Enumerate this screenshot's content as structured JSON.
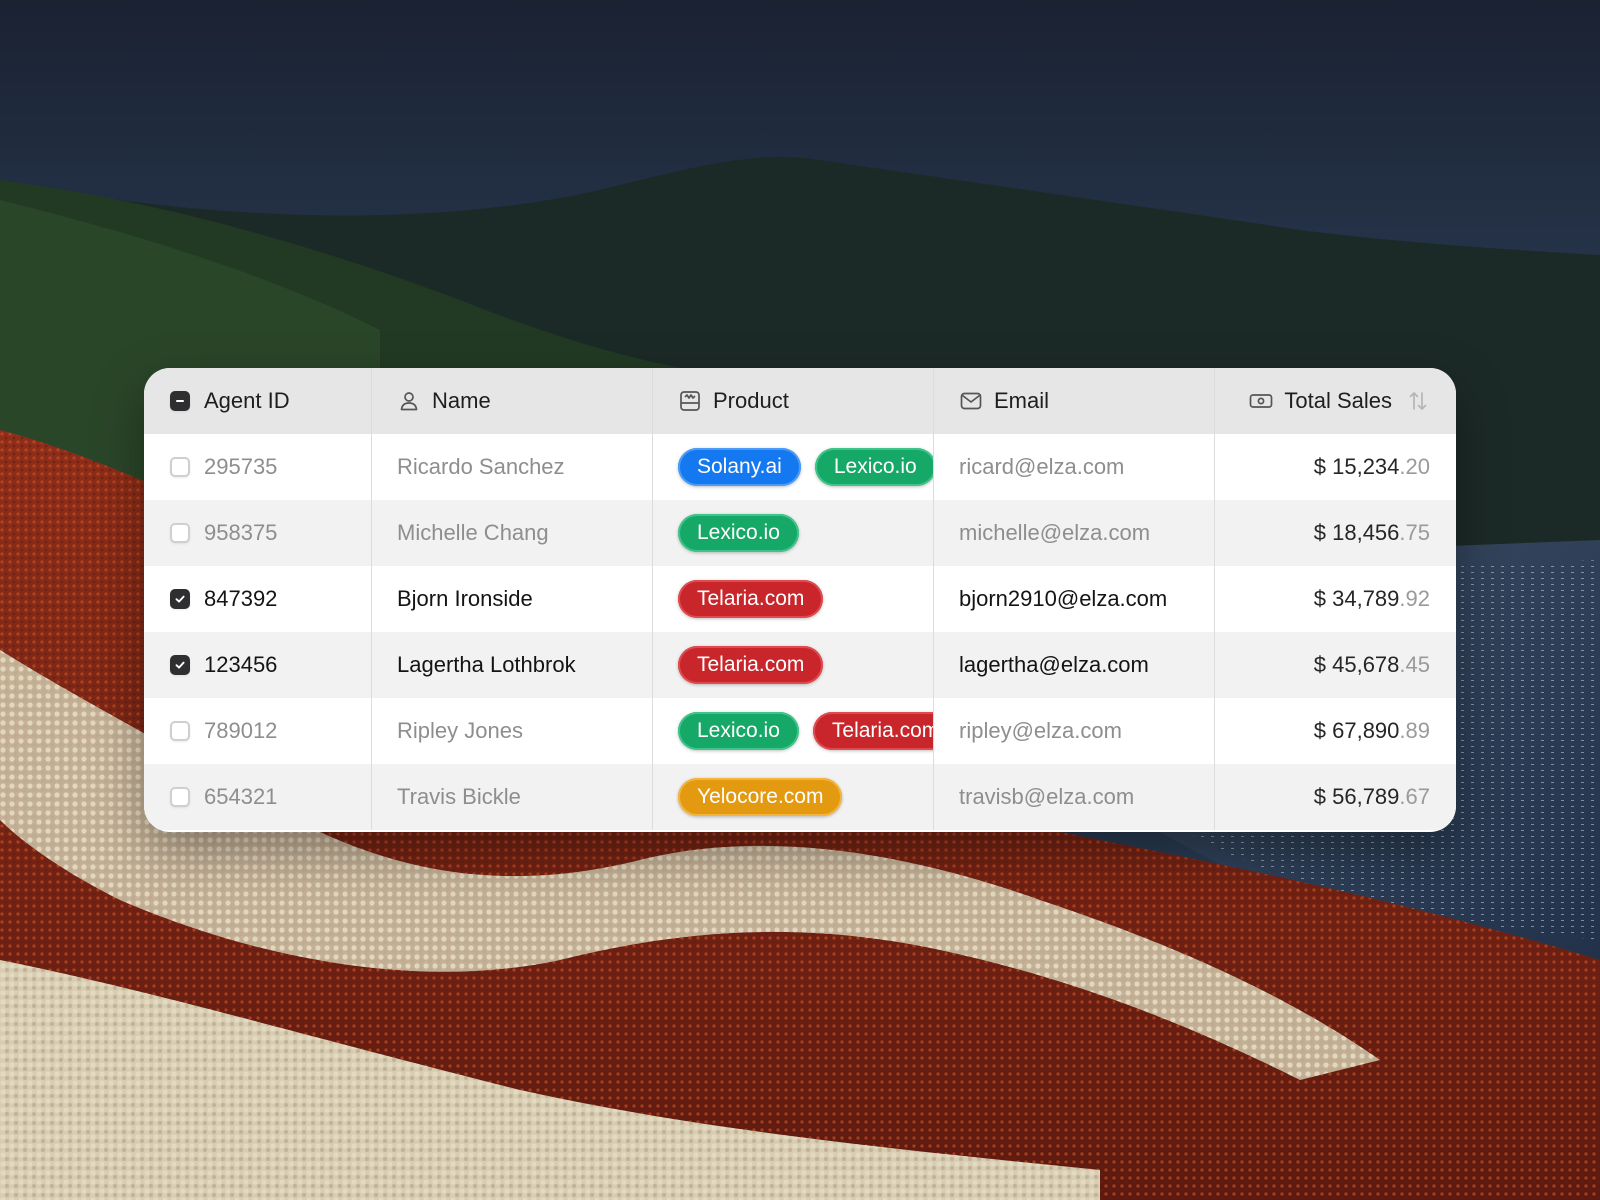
{
  "colors": {
    "header_bg": "#e6e6e6",
    "row_alt_bg": "#f2f2f2",
    "blue_pill": "#1479f0",
    "green_pill": "#16a866",
    "red_pill": "#c8262a",
    "yellow_pill": "#e39a10",
    "checkbox_checked": "#2f2f31"
  },
  "table": {
    "header": {
      "agent_id": {
        "label": "Agent ID",
        "icon": "checkbox-indeterminate-icon"
      },
      "name": {
        "label": "Name",
        "icon": "person-icon"
      },
      "product": {
        "label": "Product",
        "icon": "storefront-icon"
      },
      "email": {
        "label": "Email",
        "icon": "envelope-icon"
      },
      "total_sales": {
        "label": "Total Sales",
        "icon": "banknote-icon",
        "sort_icon": "sort-arrows-icon"
      }
    },
    "rows": [
      {
        "agent_id": "295735",
        "name": "Ricardo Sanchez",
        "checked": false,
        "products": [
          {
            "label": "Solany.ai",
            "color": "blue"
          },
          {
            "label": "Lexico.io",
            "color": "green"
          }
        ],
        "email": "ricard@elza.com",
        "sales_dollars": "$ 15,234",
        "sales_cents": ".20"
      },
      {
        "agent_id": "958375",
        "name": "Michelle Chang",
        "checked": false,
        "products": [
          {
            "label": "Lexico.io",
            "color": "green"
          }
        ],
        "email": "michelle@elza.com",
        "sales_dollars": "$ 18,456",
        "sales_cents": ".75"
      },
      {
        "agent_id": "847392",
        "name": "Bjorn Ironside",
        "checked": true,
        "products": [
          {
            "label": "Telaria.com",
            "color": "red"
          }
        ],
        "email": "bjorn2910@elza.com",
        "sales_dollars": "$ 34,789",
        "sales_cents": ".92"
      },
      {
        "agent_id": "123456",
        "name": "Lagertha Lothbrok",
        "checked": true,
        "products": [
          {
            "label": "Telaria.com",
            "color": "red"
          }
        ],
        "email": "lagertha@elza.com",
        "sales_dollars": "$ 45,678",
        "sales_cents": ".45"
      },
      {
        "agent_id": "789012",
        "name": "Ripley Jones",
        "checked": false,
        "products": [
          {
            "label": "Lexico.io",
            "color": "green"
          },
          {
            "label": "Telaria.com",
            "color": "red"
          }
        ],
        "email": "ripley@elza.com",
        "sales_dollars": "$ 67,890",
        "sales_cents": ".89"
      },
      {
        "agent_id": "654321",
        "name": "Travis Bickle",
        "checked": false,
        "products": [
          {
            "label": "Yelocore.com",
            "color": "yellow"
          }
        ],
        "email": "travisb@elza.com",
        "sales_dollars": "$ 56,789",
        "sales_cents": ".67"
      }
    ]
  }
}
